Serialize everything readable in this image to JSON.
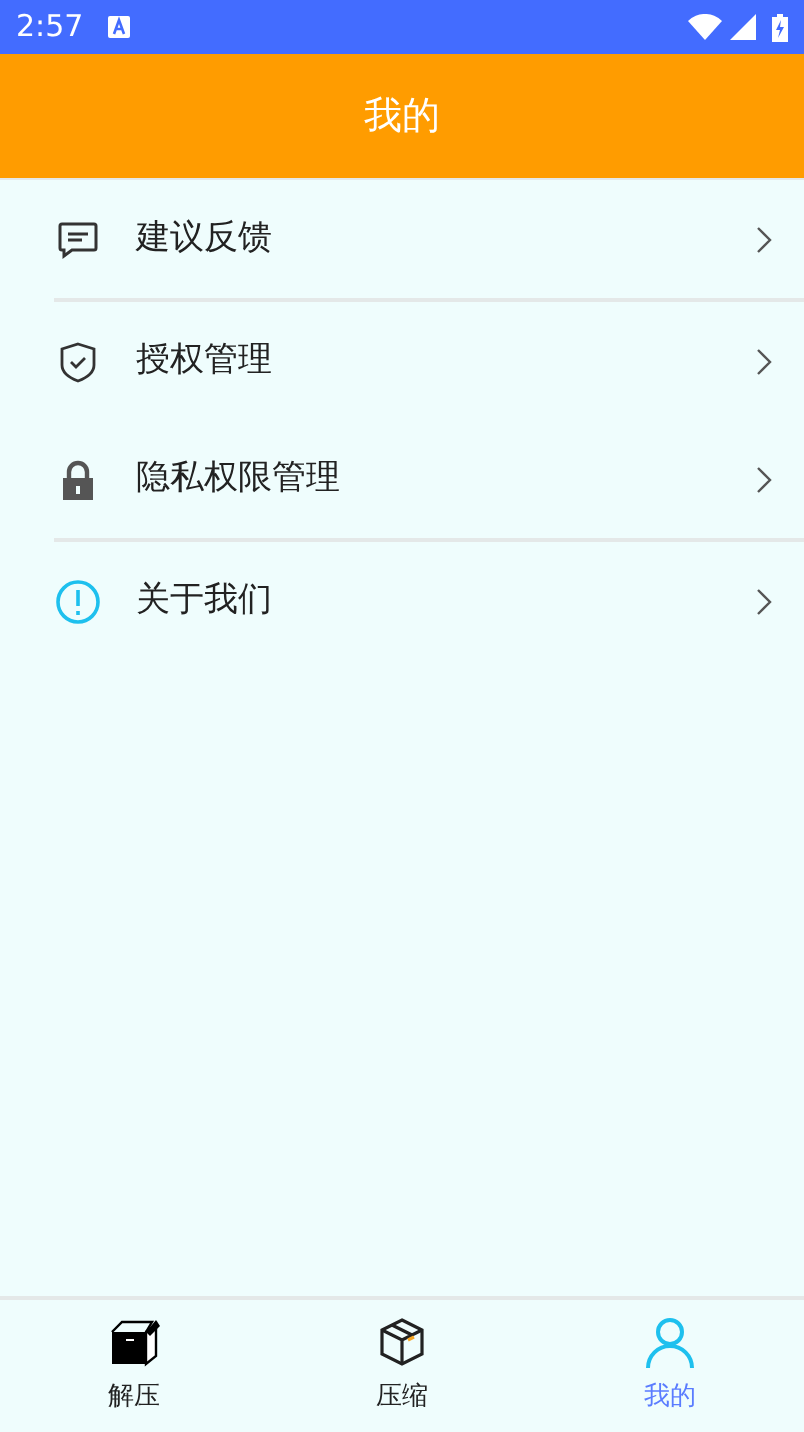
{
  "status_bar": {
    "time": "2:57"
  },
  "header": {
    "title": "我的"
  },
  "menu": [
    {
      "kind": "feedback",
      "label": "建议反馈",
      "divider_after": true
    },
    {
      "kind": "shield",
      "label": "授权管理",
      "divider_after": false
    },
    {
      "kind": "lock",
      "label": "隐私权限管理",
      "divider_after": true
    },
    {
      "kind": "info",
      "label": "关于我们",
      "divider_after": false
    }
  ],
  "tabs": [
    {
      "kind": "unzip",
      "label": "解压",
      "selected": false
    },
    {
      "kind": "zip",
      "label": "压缩",
      "selected": false
    },
    {
      "kind": "me",
      "label": "我的",
      "selected": true
    }
  ]
}
